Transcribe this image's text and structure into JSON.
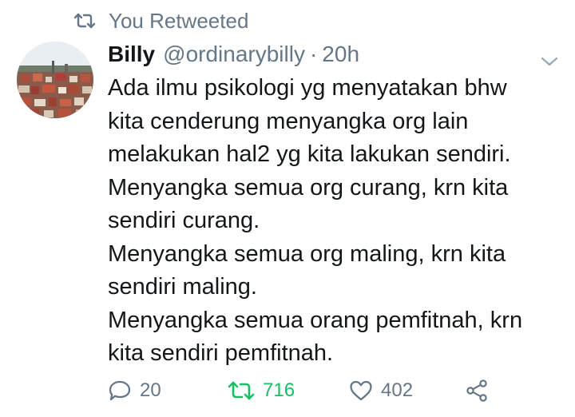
{
  "retweet_header": {
    "icon": "retweet-icon",
    "text": "You Retweeted"
  },
  "tweet": {
    "avatar_icon": "avatar",
    "author_name": "Billy",
    "author_handle": "@ordinarybilly",
    "separator": "·",
    "timestamp": "20h",
    "caret_icon": "chevron-down-icon",
    "body_lines": [
      "Ada ilmu psikologi yg menyatakan bhw",
      "kita cenderung menyangka org lain",
      "melakukan hal2 yg kita lakukan sendiri.",
      "Menyangka semua org curang, krn kita",
      "sendiri curang.",
      "Menyangka semua org maling, krn kita",
      "sendiri maling.",
      "Menyangka semua orang pemfitnah, krn",
      "kita sendiri pemfitnah."
    ]
  },
  "actions": {
    "reply_count": "20",
    "retweet_count": "716",
    "like_count": "402",
    "retweet_active_color": "#17bf63",
    "muted_color": "#657786"
  }
}
